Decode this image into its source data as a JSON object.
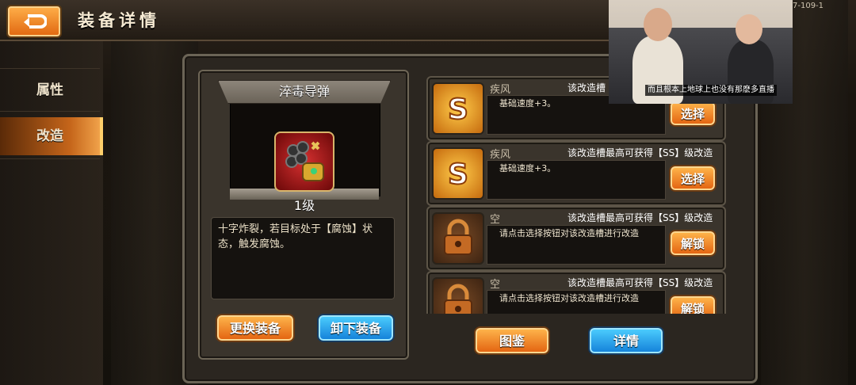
{
  "header": {
    "title": "装备详情"
  },
  "sidebar": {
    "items": [
      {
        "label": "属性",
        "active": false
      },
      {
        "label": "改造",
        "active": true
      }
    ]
  },
  "equipment": {
    "name": "淬毒导弹",
    "level": "1级",
    "description": "十字炸裂，若目标处于【腐蚀】状态，触发腐蚀。",
    "replace_label": "更换装备",
    "remove_label": "卸下装备"
  },
  "slots": [
    {
      "icon": "s-rank-icon",
      "name": "疾风",
      "hint": "该改造槽",
      "effect": "基础速度+3。",
      "button": "选择",
      "button_color": "orange"
    },
    {
      "icon": "s-rank-icon",
      "name": "疾风",
      "hint": "该改造槽最高可获得【SS】级改造",
      "effect": "基础速度+3。",
      "button": "选择",
      "button_color": "orange"
    },
    {
      "icon": "lock-icon",
      "name": "空",
      "hint": "该改造槽最高可获得【SS】级改造",
      "effect": "请点击选择按钮对该改造槽进行改造",
      "button": "解锁",
      "button_color": "orange"
    },
    {
      "icon": "lock-icon",
      "name": "空",
      "hint": "该改造槽最高可获得【SS】级改造",
      "effect": "请点击选择按钮对该改造槽进行改造",
      "button": "解锁",
      "button_color": "orange"
    }
  ],
  "footer": {
    "atlas_label": "图鉴",
    "details_label": "详情"
  },
  "overlay": {
    "caption": "而且根本上地球上也没有那麽多直播",
    "build": "7-109-1"
  },
  "colors": {
    "accent_orange": "#e2600e",
    "accent_blue": "#127ed8"
  }
}
